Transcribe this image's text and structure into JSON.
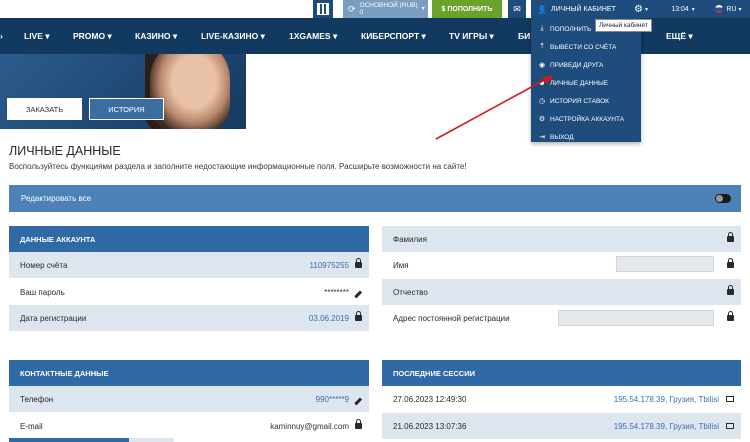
{
  "topbar": {
    "balance_label": "ОСНОВНОЙ (RUB)",
    "balance_value": "0",
    "deposit_label": "$ ПОПОЛНИТЬ",
    "cabinet_label": "ЛИЧНЫЙ КАБИНЕТ",
    "time": "13:04",
    "lang": "RU"
  },
  "nav": {
    "items": [
      "LIVE",
      "PROMO",
      "КАЗИНО",
      "LIVE-КАЗИНО",
      "1XGAMES",
      "КИБЕРСПОРТ",
      "TV ИГРЫ",
      "БИ",
      "ЕЩЁ"
    ]
  },
  "banner": {
    "order_label": "ЗАКАЗАТЬ",
    "history_label": "ИСТОРИЯ"
  },
  "dropdown": {
    "items": [
      "ПОПОЛНИТЬ",
      "ВЫВЕСТИ СО СЧЁТА",
      "ПРИВЕДИ ДРУГА",
      "ЛИЧНЫЕ ДАННЫЕ",
      "ИСТОРИЯ СТАВОК",
      "НАСТРОЙКА АККАУНТА",
      "ВЫХОД"
    ],
    "tooltip": "Личный кабинет"
  },
  "page": {
    "title": "ЛИЧНЫЕ ДАННЫЕ",
    "subtitle": "Воспользуйтесь функциями раздела и заполните недостающие информационные поля. Расширьте возможности на сайте!",
    "edit_all": "Редактировать все"
  },
  "account": {
    "header": "ДАННЫЕ АККАУНТА",
    "rows": [
      {
        "label": "Номер счёта",
        "value": "110975255"
      },
      {
        "label": "Ваш пароль",
        "value": "********"
      },
      {
        "label": "Дата регистрации",
        "value": "03.06.2019"
      }
    ]
  },
  "personal": {
    "rows": [
      {
        "label": "Фамилия"
      },
      {
        "label": "Имя"
      },
      {
        "label": "Отчество"
      },
      {
        "label": "Адрес постоянной регистрации"
      }
    ]
  },
  "contact": {
    "header": "КОНТАКТНЫЕ ДАННЫЕ",
    "rows": [
      {
        "label": "Телефон",
        "value": "990*****9"
      },
      {
        "label": "E-mail",
        "value": "kaminnuy@gmail.com"
      }
    ]
  },
  "sessions": {
    "header": "ПОСЛЕДНИЕ СЕССИИ",
    "rows": [
      {
        "date": "27.06.2023 12:49:30",
        "info": "195.54.178.39, Грузия, Tbilisi"
      },
      {
        "date": "21.06.2023 13:07:36",
        "info": "195.54.178.39, Грузия, Tbilisi"
      }
    ]
  }
}
